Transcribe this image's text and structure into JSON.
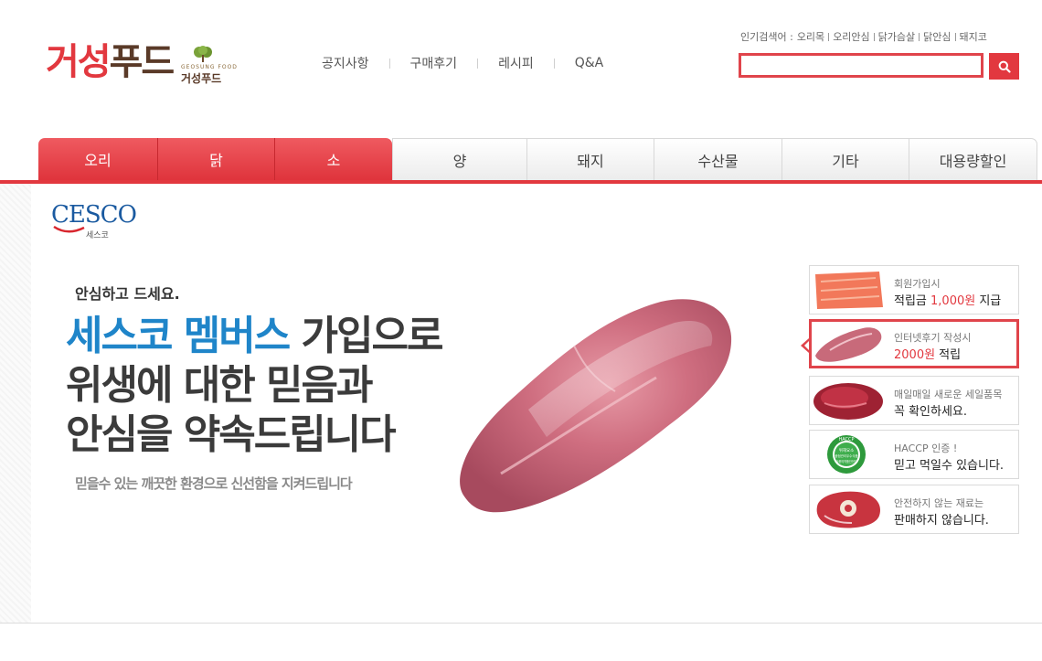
{
  "logo": {
    "main_part1": "거성",
    "main_part2": "푸드",
    "sub_en": "GEOSUNG FOOD",
    "sub_ko": "거성푸드"
  },
  "top_nav": [
    "공지사항",
    "구매후기",
    "레시피",
    "Q&A"
  ],
  "popular_search": {
    "label": "인기검색어 :",
    "keywords": [
      "오리목",
      "오리안심",
      "닭가슴살",
      "닭안심",
      "돼지코"
    ]
  },
  "search": {
    "placeholder": "",
    "icon": "search-icon",
    "accent": "#e2383f"
  },
  "categories": [
    "오리",
    "닭",
    "소",
    "양",
    "돼지",
    "수산물",
    "기타",
    "대용량할인"
  ],
  "banner": {
    "brand": "CESCO",
    "brand_ko": "세스코",
    "headline_small": "안심하고 드세요.",
    "headline_blue": "세스코 멤버스",
    "headline_line1_rest": " 가입으로",
    "headline_line2": "위생에 대한 믿음과",
    "headline_line3": "안심을 약속드립니다",
    "subline": "믿을수 있는 깨끗한 환경으로 신선함을 지켜드립니다"
  },
  "benefits": [
    {
      "line1": "회원가입시",
      "line2_pre": "적립금 ",
      "line2_red": "1,000원",
      "line2_post": " 지급",
      "thumb": "salmon-image",
      "active": false
    },
    {
      "line1": "인터넷후기 작성시",
      "line2_pre": "",
      "line2_red": "2000원",
      "line2_post": " 적립",
      "thumb": "meat-image",
      "active": true
    },
    {
      "line1": "매일매일 새로운 세일품목",
      "line2_pre": "꼭 확인하세요.",
      "line2_red": "",
      "line2_post": "",
      "thumb": "beef-image",
      "active": false
    },
    {
      "line1": "HACCP 인증 !",
      "line2_pre": "믿고 먹일수 있습니다.",
      "line2_red": "",
      "line2_post": "",
      "thumb": "haccp-seal",
      "active": false
    },
    {
      "line1": "안전하지 않는 재료는",
      "line2_pre": "판매하지 않습니다.",
      "line2_red": "",
      "line2_post": "",
      "thumb": "bone-meat-image",
      "active": false
    }
  ],
  "haccp_seal": {
    "ring": "HACCP",
    "center1": "위해요소",
    "center2": "중점관리우수식품",
    "center3": "식품의약품안전처"
  }
}
